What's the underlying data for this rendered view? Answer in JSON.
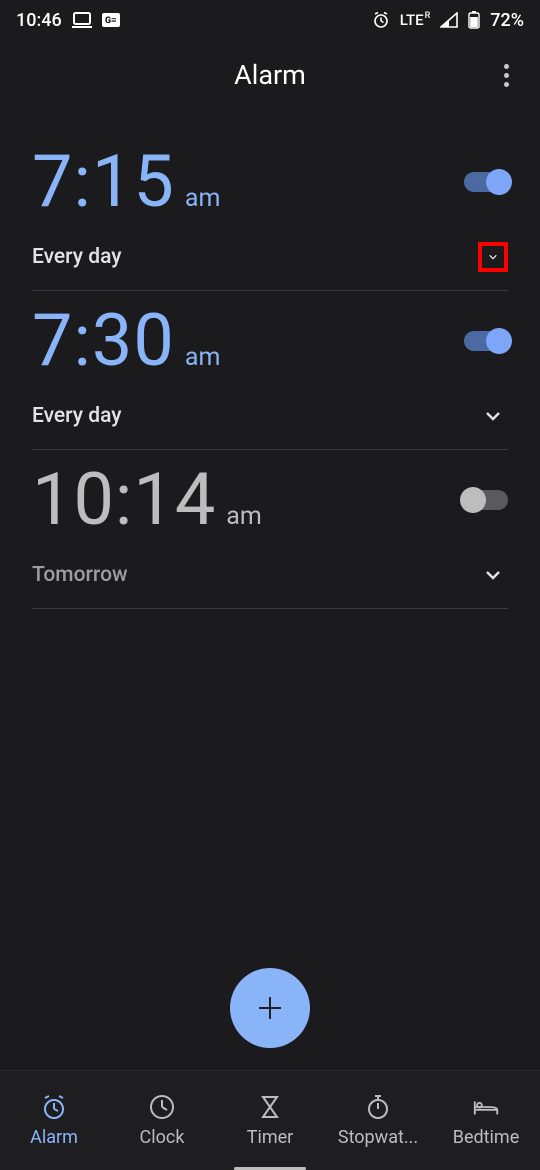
{
  "status": {
    "time": "10:46",
    "lte": "LTE",
    "lte_sup": "R",
    "battery": "72%"
  },
  "header": {
    "title": "Alarm"
  },
  "alarms": [
    {
      "time": "7:15",
      "ampm": "am",
      "schedule": "Every day",
      "enabled": true
    },
    {
      "time": "7:30",
      "ampm": "am",
      "schedule": "Every day",
      "enabled": true
    },
    {
      "time": "10:14",
      "ampm": "am",
      "schedule": "Tomorrow",
      "enabled": false
    }
  ],
  "nav": {
    "items": [
      {
        "label": "Alarm"
      },
      {
        "label": "Clock"
      },
      {
        "label": "Timer"
      },
      {
        "label": "Stopwat..."
      },
      {
        "label": "Bedtime"
      }
    ]
  }
}
